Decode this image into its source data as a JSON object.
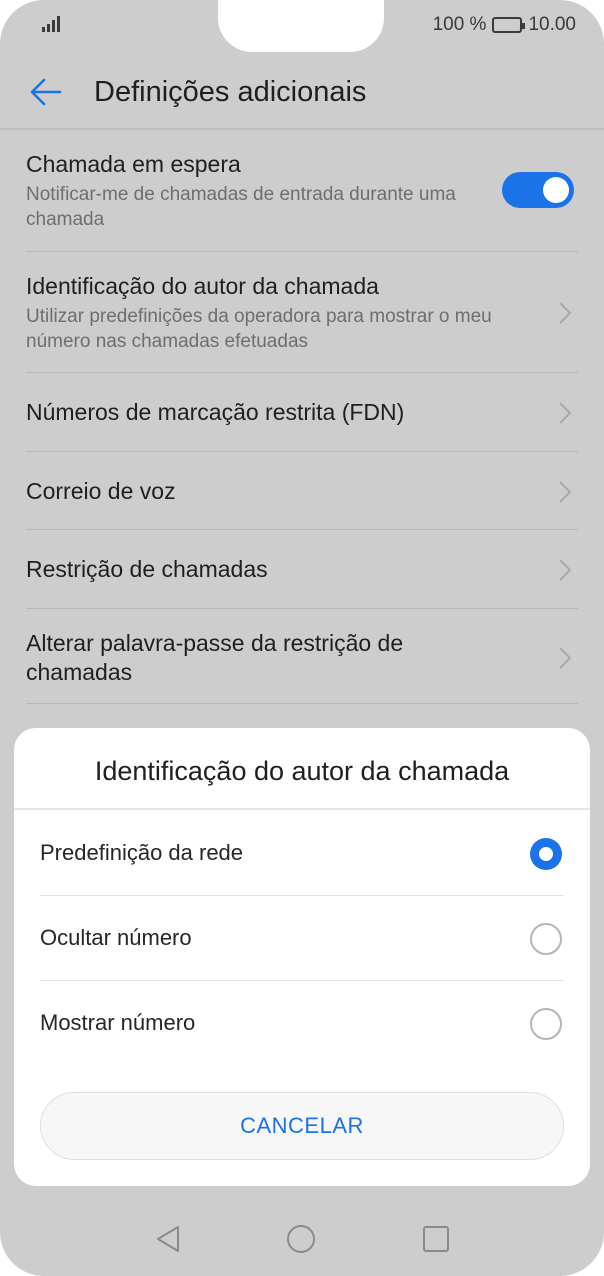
{
  "status_bar": {
    "battery_text": "100 %",
    "time": "10.00",
    "icons": [
      "signal-icon",
      "battery-icon"
    ]
  },
  "header": {
    "back_icon": "back-arrow-icon",
    "title": "Definições adicionais"
  },
  "settings": {
    "items": [
      {
        "title": "Chamada em espera",
        "subtitle": "Notificar-me de chamadas de entrada durante uma chamada",
        "control": "toggle",
        "toggle_on": true
      },
      {
        "title": "Identificação do autor da chamada",
        "subtitle": "Utilizar predefinições da operadora para mostrar o meu número nas chamadas efetuadas",
        "control": "chevron"
      },
      {
        "title": "Números de marcação restrita (FDN)",
        "control": "chevron"
      },
      {
        "title": "Correio de voz",
        "control": "chevron"
      },
      {
        "title": "Restrição de chamadas",
        "control": "chevron"
      },
      {
        "title": "Alterar palavra-passe da restrição de chamadas",
        "control": "chevron"
      }
    ]
  },
  "dialog": {
    "title": "Identificação do autor da chamada",
    "options": [
      {
        "label": "Predefinição da rede",
        "selected": true
      },
      {
        "label": "Ocultar número",
        "selected": false
      },
      {
        "label": "Mostrar número",
        "selected": false
      }
    ],
    "cancel_label": "CANCELAR"
  },
  "nav_bar": {
    "icons": [
      "back-triangle-icon",
      "home-circle-icon",
      "recents-square-icon"
    ]
  },
  "colors": {
    "accent": "#1a73e8",
    "dimmed_background": "#cdcdcd",
    "sheet_background": "#ffffff"
  }
}
